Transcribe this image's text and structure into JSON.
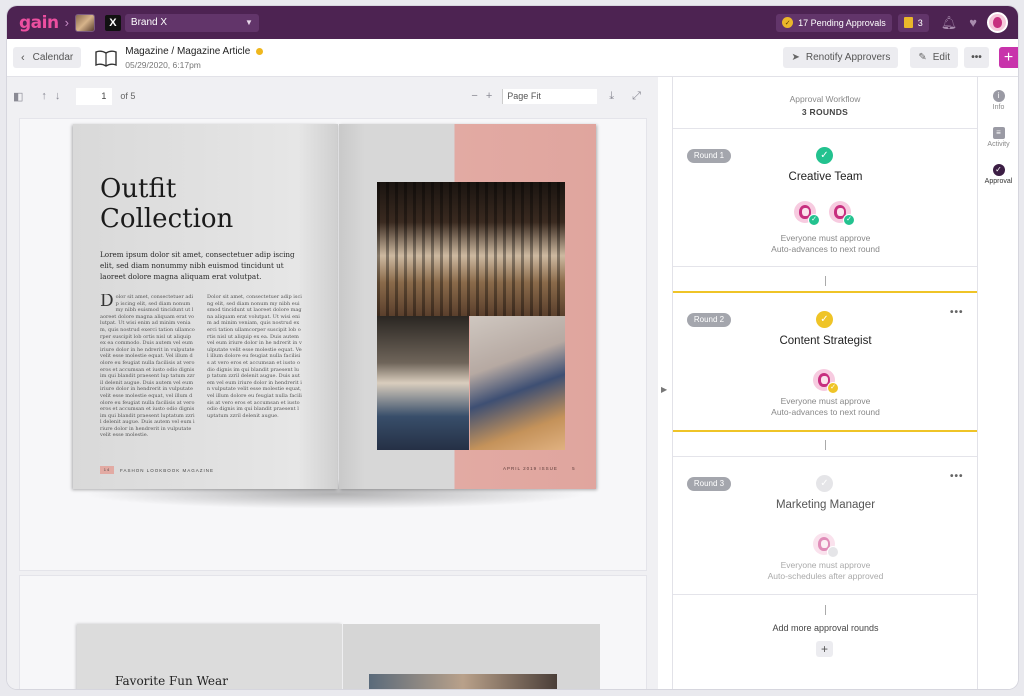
{
  "app": {
    "logo": "gain",
    "brand_name": "Brand X",
    "brand_badge": "X",
    "pending_approvals": "17 Pending Approvals",
    "tasks_count": "3"
  },
  "header": {
    "back_label": "Calendar",
    "doc_title": "Magazine / Magazine Article",
    "doc_date": "05/29/2020, 6:17pm",
    "renotify_label": "Renotify Approvers",
    "edit_label": "Edit",
    "more_label": "•••",
    "plus_label": "+"
  },
  "viewer": {
    "page_value": "1",
    "page_total": "of 5",
    "zoom_label": "Page Fit"
  },
  "magazine": {
    "title_line1": "Outfit",
    "title_line2": "Collection",
    "intro": "Lorem ipsum dolor sit amet, consectetuer adip iscing elit, sed diam nonummy nibh euismod tincidunt ut laoreet dolore magna aliquam erat volutpat.",
    "col1": "olor sit amet, consectetuer adip iscing elit, sed diam nonum my nibh euismod tincidunt ut laoreet dolore magna aliquam erat volutpat. Ut wisi enim ad minim veniam, quis nostrud exerci tation ullamcorper suscipit lob ortis nisl ut aliquip ex ea commodo. Duis autem vel eum iriure dolor in he ndrerit in vulputate velit esse molestie equat. Vel illum dolore eu feugiat nulla facilisis at vero eros et accumsan et iusto odio dignis im qui blandit praesent lup tatum zzril delenit augue. Duis autem vel eum iriure dolor in hendrerit in vulputate velit esse molestie equat, vel illum dolore eu feugiat nulla facilisis at vero eros et accumsan et iusto odio dignis im qui blandit praesent luptatum zzril delenit augue. Duis autem vel eum iriure dolor in hendrerit in vulputate velit esse molestie.",
    "col1_dropcap": "D",
    "col2": "Dolor sit amet, consectetuer adip iscing elit, sed diam nonum my nibh euismod tincidunt ut laoreet dolore magna aliquam erat volutpat. Ut wisi enim ad minim veniam, quis nostrud exerci tation ullamcorper suscipit lob ortis nisl ut aliquip ex ea. Duis autem vel eum iriure dolor in he ndrerit in vulputate velit esse molestie equat. Vel illum dolore eu feugiat nulla facilisis at vero eros et accumsan et iusto odio dignis im qui blandit praesent lup tatum zzril delenit augue. Duis autem vel eum iriure dolor in hendrerit in vulputate velit esse molestie equat, vel illum dolore eu feugiat nulla facilisis at vero eros et accumsan et iusto odio dignis im qui blandit praesent luptatum zzril delenit augue.",
    "footer_left": "FASHON LOOKBOOK MAGAZINE",
    "footer_left_page": "14",
    "footer_right": "APRIL 2019 ISSUE",
    "footer_right_page": "5",
    "next_title": "Favorite Fun Wear"
  },
  "workflow": {
    "heading": "Approval Workflow",
    "rounds_count": "3 ROUNDS",
    "rounds": [
      {
        "badge": "Round 1",
        "name": "Creative Team",
        "note1": "Everyone must approve",
        "note2": "Auto-advances to next round",
        "status_color": "#23c28f"
      },
      {
        "badge": "Round 2",
        "name": "Content Strategist",
        "note1": "Everyone must approve",
        "note2": "Auto-advances to next round",
        "status_color": "#efc427"
      },
      {
        "badge": "Round 3",
        "name": "Marketing Manager",
        "note1": "Everyone must approve",
        "note2": "Auto-schedules after approved",
        "status_color": "#d0d0d6"
      }
    ],
    "round_more": "•••",
    "add_rounds_label": "Add more approval rounds",
    "add_plus": "+"
  },
  "rail": {
    "items": [
      {
        "label": "Info",
        "icon": "info-icon"
      },
      {
        "label": "Activity",
        "icon": "comment-icon"
      },
      {
        "label": "Approval",
        "icon": "check-circle-icon"
      }
    ]
  },
  "colors": {
    "topbar": "#4d2352",
    "accent": "#c833ab",
    "approved": "#23c28f",
    "pending": "#efc427"
  }
}
